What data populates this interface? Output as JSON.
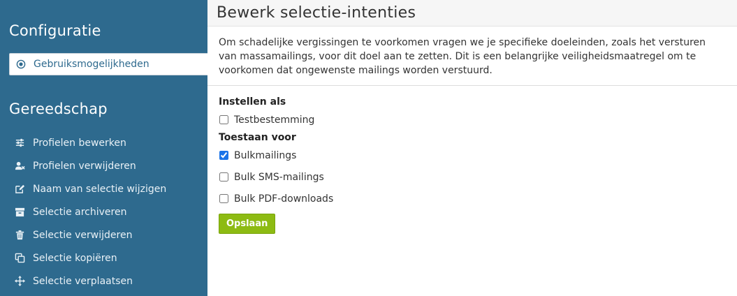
{
  "sidebar": {
    "config_title": "Configuratie",
    "active_item": {
      "label": "Gebruiksmogelijkheden",
      "icon": "target-icon"
    },
    "tools_title": "Gereedschap",
    "tools": [
      {
        "label": "Profielen bewerken",
        "icon": "sliders-icon"
      },
      {
        "label": "Profielen verwijderen",
        "icon": "user-remove-icon"
      },
      {
        "label": "Naam van selectie wijzigen",
        "icon": "edit-icon"
      },
      {
        "label": "Selectie archiveren",
        "icon": "archive-icon"
      },
      {
        "label": "Selectie verwijderen",
        "icon": "trash-icon"
      },
      {
        "label": "Selectie kopiëren",
        "icon": "copy-icon"
      },
      {
        "label": "Selectie verplaatsen",
        "icon": "move-icon"
      }
    ]
  },
  "main": {
    "title": "Bewerk selectie-intenties",
    "intro": "Om schadelijke vergissingen te voorkomen vragen we je specifieke doeleinden, zoals het versturen van massamailings, voor dit doel aan te zetten. Dit is een belangrijke veiligheidsmaatregel om te voorkomen dat ongewenste mailings worden verstuurd.",
    "set_as_label": "Instellen als",
    "set_as_options": [
      {
        "label": "Testbestemming",
        "checked": false
      }
    ],
    "allow_for_label": "Toestaan voor",
    "allow_for_options": [
      {
        "label": "Bulkmailings",
        "checked": true
      },
      {
        "label": "Bulk SMS-mailings",
        "checked": false
      },
      {
        "label": "Bulk PDF-downloads",
        "checked": false
      }
    ],
    "save_label": "Opslaan"
  },
  "colors": {
    "sidebar_bg": "#2e6a8e",
    "save_button": "#8dbb13",
    "checkbox_accent": "#1a73e8"
  }
}
